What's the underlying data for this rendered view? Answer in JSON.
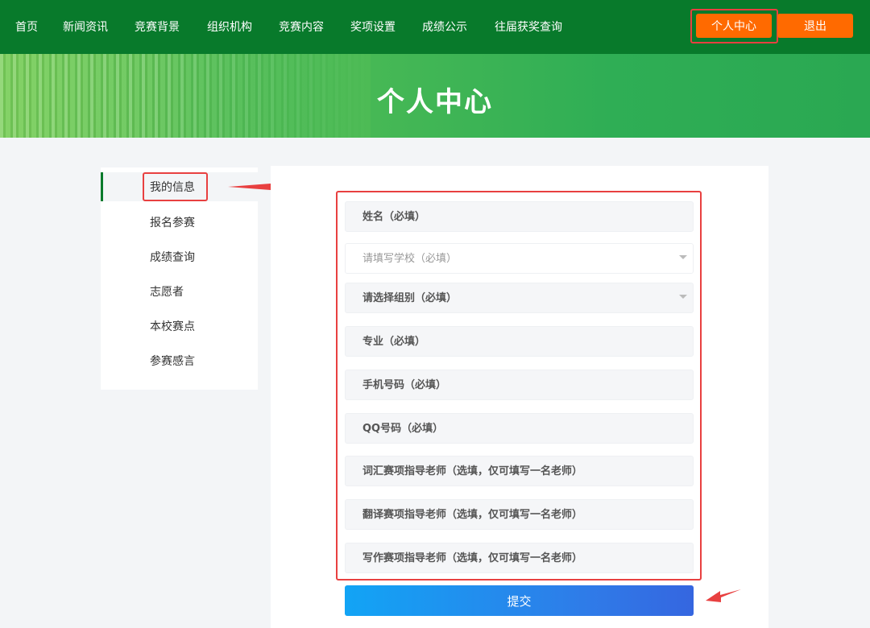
{
  "nav": {
    "items": [
      "首页",
      "新闻资讯",
      "竞赛背景",
      "组织机构",
      "竞赛内容",
      "奖项设置",
      "成绩公示",
      "往届获奖查询"
    ],
    "personal_center": "个人中心",
    "logout": "退出"
  },
  "banner": {
    "title": "个人中心"
  },
  "sidebar": {
    "items": [
      "我的信息",
      "报名参赛",
      "成绩查询",
      "志愿者",
      "本校赛点",
      "参赛感言"
    ],
    "active": "我的信息"
  },
  "form": {
    "name_placeholder": "姓名（必填）",
    "school_placeholder": "请填写学校（必填）",
    "group_placeholder": "请选择组别（必填）",
    "major_placeholder": "专业（必填）",
    "phone_placeholder": "手机号码（必填）",
    "qq_placeholder": "QQ号码（必填）",
    "vocab_teacher_placeholder": "词汇赛项指导老师（选填，仅可填写一名老师）",
    "translate_teacher_placeholder": "翻译赛项指导老师（选填，仅可填写一名老师）",
    "writing_teacher_placeholder": "写作赛项指导老师（选填，仅可填写一名老师）",
    "submit": "提交"
  },
  "colors": {
    "nav_bg": "#087a2b",
    "accent_orange": "#ff6a00",
    "highlight_red": "#e84040",
    "submit_gradient_start": "#12a4f5",
    "submit_gradient_end": "#3566e0"
  }
}
